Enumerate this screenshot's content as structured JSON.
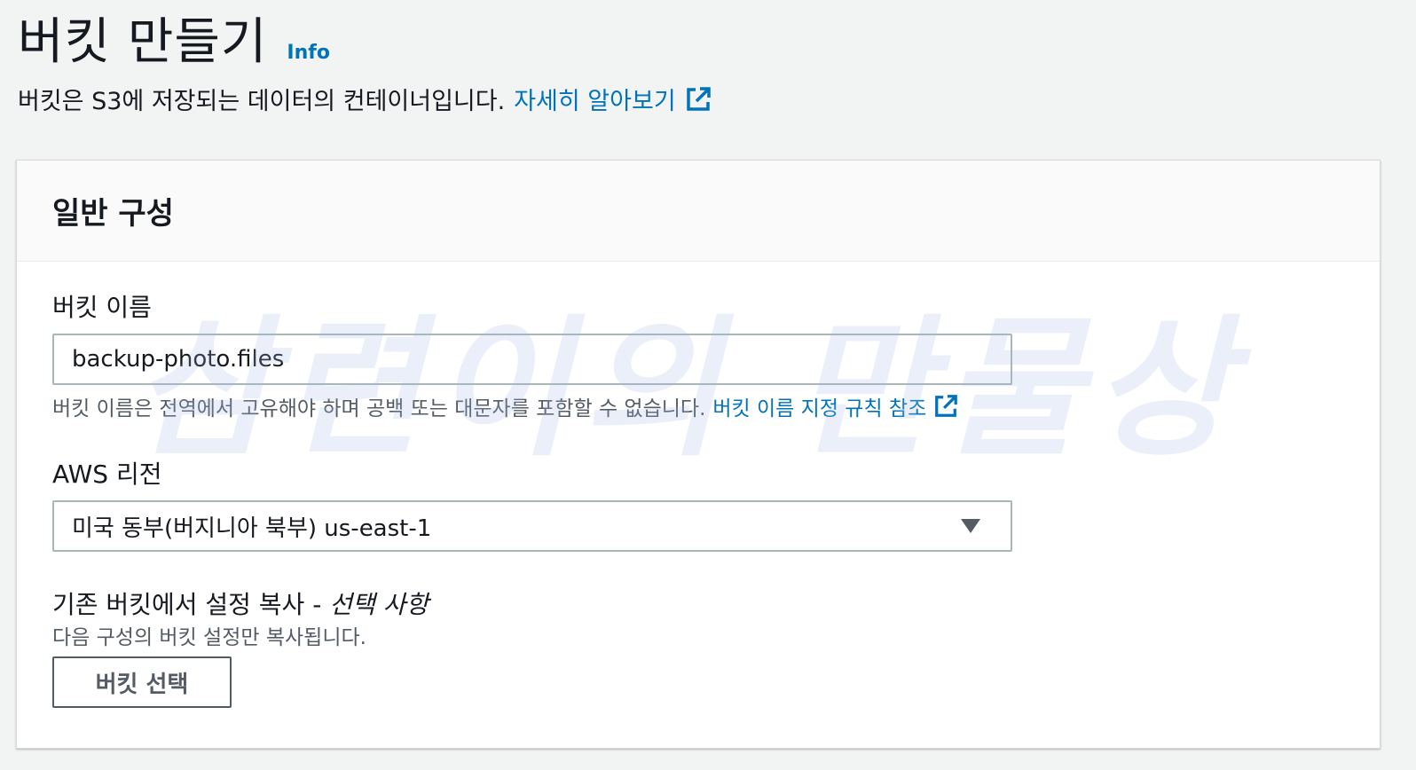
{
  "header": {
    "title": "버킷 만들기",
    "info_link": "Info",
    "description": "버킷은 S3에 저장되는 데이터의 컨테이너입니다.",
    "learn_more_link": "자세히 알아보기"
  },
  "general_config": {
    "section_title": "일반 구성",
    "bucket_name": {
      "label": "버킷 이름",
      "value": "backup-photo.files",
      "hint": "버킷 이름은 전역에서 고유해야 하며 공백 또는 대문자를 포함할 수 없습니다.",
      "rules_link": "버킷 이름 지정 규칙 참조"
    },
    "region": {
      "label": "AWS 리전",
      "selected": "미국 동부(버지니아 북부) us-east-1"
    },
    "copy_settings": {
      "label": "기존 버킷에서 설정 복사 - ",
      "optional": "선택 사항",
      "hint": "다음 구성의 버킷 설정만 복사됩니다.",
      "button_label": "버킷 선택"
    }
  },
  "watermark": "삼련이의 만물상",
  "colors": {
    "link": "#0073bb",
    "background": "#f2f3f3",
    "panel_border": "#d5dbdb"
  }
}
